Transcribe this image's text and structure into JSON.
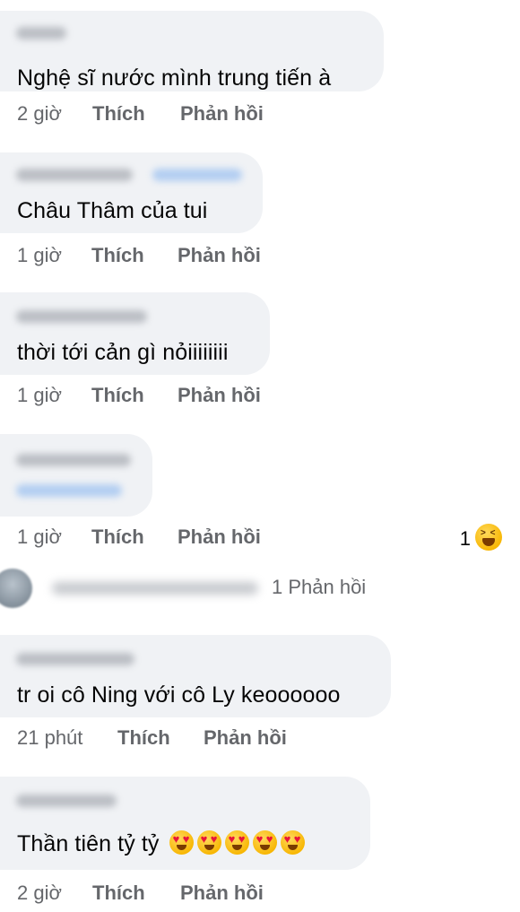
{
  "comments": [
    {
      "text": "Nghệ sĩ nước mình trung tiến à",
      "time": "2 giờ",
      "like": "Thích",
      "reply": "Phản hồi"
    },
    {
      "text": "Châu Thâm của tui",
      "time": "1 giờ",
      "like": "Thích",
      "reply": "Phản hồi"
    },
    {
      "text": "thời tới cản gì nỏiiiiiiii",
      "time": "1 giờ",
      "like": "Thích",
      "reply": "Phản hồi"
    },
    {
      "text": "",
      "time": "1 giờ",
      "like": "Thích",
      "reply": "Phản hồi",
      "reaction_count": "1",
      "reaction_icon": "laughing-emoji-icon"
    },
    {
      "text": "tr oi cô Ning với cô Ly keoooooo",
      "time": "21 phút",
      "like": "Thích",
      "reply": "Phản hồi"
    },
    {
      "text": "Thần tiên tỷ tỷ",
      "emojis": [
        "heart-eyes-emoji-icon",
        "heart-eyes-emoji-icon",
        "heart-eyes-emoji-icon",
        "heart-eyes-emoji-icon",
        "heart-eyes-emoji-icon"
      ],
      "time": "2 giờ",
      "like": "Thích",
      "reply": "Phản hồi"
    }
  ],
  "reply_thread": {
    "label": "1 Phản hồi"
  },
  "colors": {
    "bubble": "#f0f2f5",
    "meta_text": "#65676b",
    "body_text": "#050505"
  }
}
